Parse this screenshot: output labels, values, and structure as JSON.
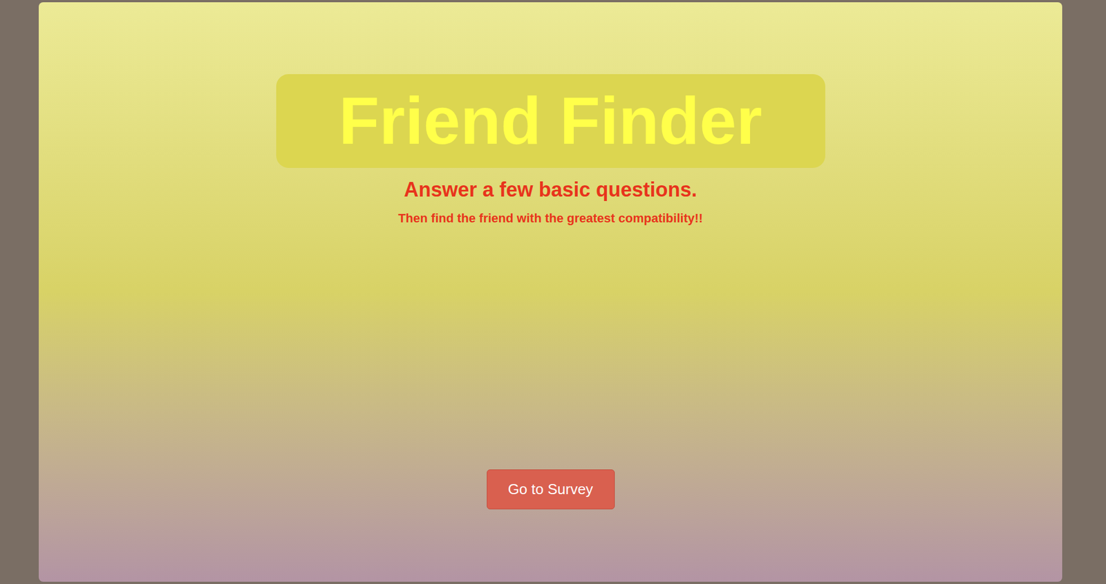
{
  "hero": {
    "title": "Friend Finder",
    "subtitle": "Answer a few basic questions.",
    "tagline": "Then find the friend with the greatest compatibility!!"
  },
  "buttons": [
    {
      "label": "Go to Survey"
    }
  ]
}
